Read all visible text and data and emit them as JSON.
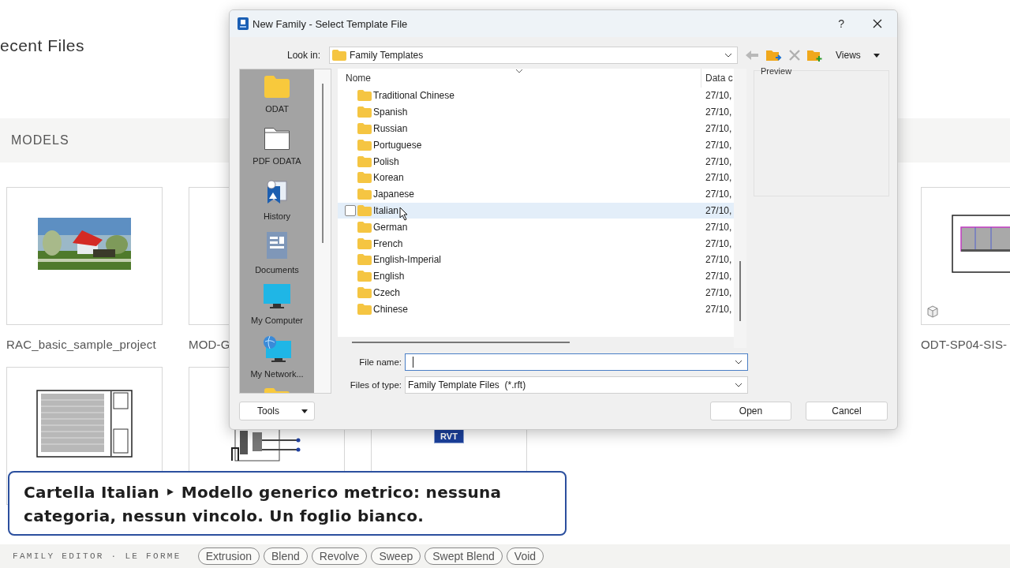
{
  "background": {
    "heading": "ecent Files",
    "section": "MODELS",
    "cards": [
      {
        "label": "RAC_basic_sample_project",
        "kind": "render"
      },
      {
        "label": "MOD-G",
        "kind": "blank"
      },
      {
        "label": "ODT-SP04-SIS-",
        "kind": "sheet_wide"
      }
    ],
    "cards_row_2": [
      {
        "kind": "sheet"
      },
      {
        "kind": "piping"
      },
      {
        "kind": "badge",
        "badge": "RVT"
      }
    ]
  },
  "dialog": {
    "title": "New Family - Select Template File",
    "help": "?",
    "look_in": {
      "label": "Look in:",
      "value": "Family Templates"
    },
    "toolbar": [
      {
        "kind": "back",
        "disabled": true
      },
      {
        "kind": "up",
        "disabled": false
      },
      {
        "kind": "delete",
        "disabled": true
      },
      {
        "kind": "new_folder",
        "disabled": false
      }
    ],
    "views": "Views",
    "places": [
      {
        "kind": "folder",
        "label": "ODAT"
      },
      {
        "kind": "blank_folder",
        "label": "PDF ODATA"
      },
      {
        "kind": "history",
        "label": "History"
      },
      {
        "kind": "documents",
        "label": "Documents"
      },
      {
        "kind": "computer",
        "label": "My Computer"
      },
      {
        "kind": "network",
        "label": "My Network..."
      },
      {
        "kind": "folder"
      }
    ],
    "columns": [
      "Nome",
      "Data c"
    ],
    "rows": [
      {
        "name": "Traditional Chinese",
        "date": "27/10,",
        "selected": false
      },
      {
        "name": "Spanish",
        "date": "27/10,",
        "selected": false
      },
      {
        "name": "Russian",
        "date": "27/10,",
        "selected": false
      },
      {
        "name": "Portuguese",
        "date": "27/10,",
        "selected": false
      },
      {
        "name": "Polish",
        "date": "27/10,",
        "selected": false
      },
      {
        "name": "Korean",
        "date": "27/10,",
        "selected": false
      },
      {
        "name": "Japanese",
        "date": "27/10,",
        "selected": false
      },
      {
        "name": "Italian",
        "date": "27/10,",
        "selected": true
      },
      {
        "name": "German",
        "date": "27/10,",
        "selected": false
      },
      {
        "name": "French",
        "date": "27/10,",
        "selected": false
      },
      {
        "name": "English-Imperial",
        "date": "27/10,",
        "selected": false
      },
      {
        "name": "English",
        "date": "27/10,",
        "selected": false
      },
      {
        "name": "Czech",
        "date": "27/10,",
        "selected": false
      },
      {
        "name": "Chinese",
        "date": "27/10,",
        "selected": false
      }
    ],
    "preview_label": "Preview",
    "file_name": {
      "label": "File name:"
    },
    "file_type": {
      "label": "Files of type:",
      "value": "Family Template Files  (*.rft)"
    },
    "buttons": {
      "tools": "Tools",
      "open": "Open",
      "cancel": "Cancel"
    }
  },
  "caption": "Cartella Italian ‣ Modello generico metrico: nessuna categoria, nessun vincolo. Un foglio bianco.",
  "footer": {
    "label": "FAMILY EDITOR · LE FORME",
    "tags": [
      "Extrusion",
      "Blend",
      "Revolve",
      "Sweep",
      "Swept Blend",
      "Void"
    ]
  }
}
